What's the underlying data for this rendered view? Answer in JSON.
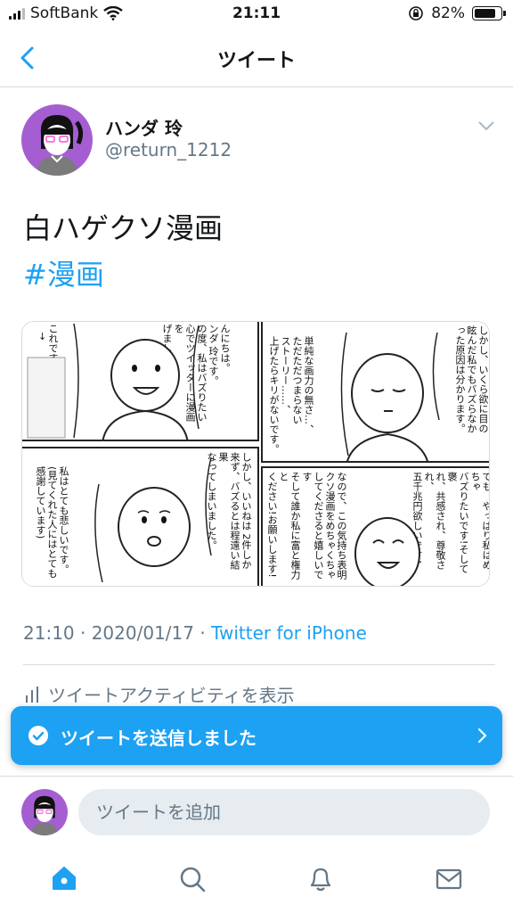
{
  "status_bar": {
    "carrier": "SoftBank",
    "time": "21:11",
    "battery": "82%",
    "battery_level": 0.82
  },
  "nav": {
    "title": "ツイート"
  },
  "tweet": {
    "display_name": "ハンダ 玲",
    "handle": "@return_1212",
    "text": "白ハゲクソ漫画",
    "hashtag": "#漫画",
    "timestamp": "21:10 · 2020/01/17 · ",
    "source": "Twitter for iPhone",
    "activity_label": "ツイートアクティビティを表示"
  },
  "manga": {
    "panel1": [
      "んにちは。",
      "ンダ 玲です。",
      "の度、私はバズりたい",
      "心でツイッターに漫画を",
      "げました。"
    ],
    "panel1_bubble": [
      "これです)",
      "↓"
    ],
    "panel2": [
      "しかし、いくら欲に目の",
      "眩んだ私でもバズらなか",
      "った原因は分かります。"
    ],
    "panel2_b": [
      "単純な画力の無さ…、",
      "ただただつまらない",
      "ストーリー……、",
      "上げたらキリがないです。"
    ],
    "panel3": [
      "しかし、いいねは 2件しか",
      "来ず、バズるとは程遠い結果",
      "なってしまいました。"
    ],
    "panel3_b": [
      "私はとても悲しいです。",
      "(見てくれた人にはとても",
      "感謝しています)"
    ],
    "panel4": [
      "でも、やっぱり私はめちゃ",
      "バズりたいです!そして褒",
      "れ、共感され、尊敬され、",
      "五千兆円欲しいです!"
    ],
    "panel4_b": [
      "なので、この気持ち表明",
      "クソ漫画をめちゃくちゃ",
      "してくださると嬉しいです",
      "そして誰か私に富と権力と",
      "ください!お願いします!"
    ]
  },
  "toast": {
    "text": "ツイートを送信しました"
  },
  "reply": {
    "placeholder": "ツイートを追加"
  },
  "tabs": [
    "home-icon",
    "search-icon",
    "notifications-icon",
    "messages-icon"
  ],
  "colors": {
    "accent": "#1da1f2",
    "secondary_text": "#657786",
    "avatar_bg": "#a55ed2"
  }
}
